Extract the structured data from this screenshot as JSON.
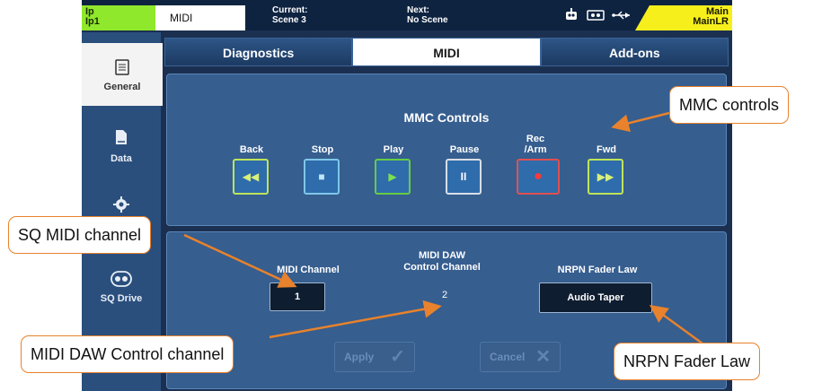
{
  "topbar": {
    "ip_line1": "Ip",
    "ip_line2": "Ip1",
    "midi_label": "MIDI",
    "current_label": "Current:",
    "current_value": "Scene 3",
    "next_label": "Next:",
    "next_value": "No Scene",
    "main_line1": "Main",
    "main_line2": "MainLR",
    "icons": [
      "robot-icon",
      "device-icon",
      "usb-icon"
    ]
  },
  "sidebar": {
    "items": [
      {
        "label": "General",
        "icon": "document-icon",
        "active": true
      },
      {
        "label": "Data",
        "icon": "data-usb-icon",
        "active": false
      },
      {
        "label": "",
        "icon": "gear-icon",
        "active": false
      },
      {
        "label": "SQ Drive",
        "icon": "sq-drive-icon",
        "active": false
      }
    ]
  },
  "tabs": [
    {
      "label": "Diagnostics",
      "active": false
    },
    {
      "label": "MIDI",
      "active": true
    },
    {
      "label": "Add-ons",
      "active": false
    }
  ],
  "mmc": {
    "title": "MMC Controls",
    "buttons": [
      {
        "label": "Back",
        "glyph": "◀◀",
        "border": "#bfe45a"
      },
      {
        "label": "Stop",
        "glyph": "■",
        "border": "#7fc7e8"
      },
      {
        "label": "Play",
        "glyph": "▶",
        "border": "#66cc44"
      },
      {
        "label": "Pause",
        "glyph": "II",
        "border": "#d8dee6"
      },
      {
        "label": "Rec /Arm",
        "label_line1": "Rec",
        "label_line2": "/Arm",
        "glyph": "●",
        "border": "#e05050"
      },
      {
        "label": "Fwd",
        "glyph": "▶▶",
        "border": "#bfe45a"
      }
    ]
  },
  "midi_settings": {
    "channel_label": "MIDI Channel",
    "channel_value": "1",
    "daw_label_line1": "MIDI DAW",
    "daw_label_line2": "Control Channel",
    "daw_value": "2",
    "nrpn_label": "NRPN Fader Law",
    "nrpn_value": "Audio Taper",
    "apply_label": "Apply",
    "cancel_label": "Cancel"
  },
  "callouts": {
    "mmc": "MMC controls",
    "sq_midi": "SQ MIDI channel",
    "daw": "MIDI DAW Control channel",
    "nrpn": "NRPN Fader Law"
  },
  "colors": {
    "accent_green": "#8fe82c",
    "accent_yellow": "#f6ef1c",
    "callout_border": "#e8822c",
    "background": "#1b3050"
  }
}
